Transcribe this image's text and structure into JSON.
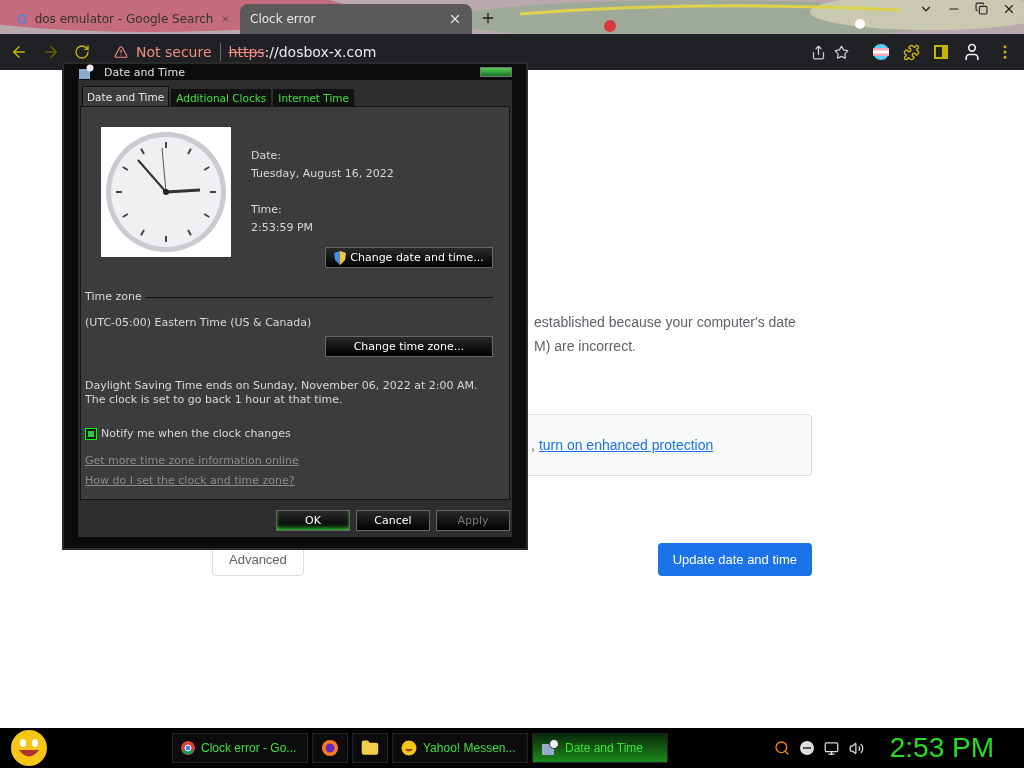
{
  "browser": {
    "tabs": [
      {
        "title": "dos emulator - Google Search",
        "selected": false
      },
      {
        "title": "Clock error",
        "selected": true
      }
    ],
    "security": "Not secure",
    "url_scheme": "https",
    "url_rest": "://dosbox-x.com"
  },
  "page": {
    "lines": [
      "established because your computer's date",
      "M) are incorrect."
    ],
    "card_prefix": ",",
    "card_link": "turn on enhanced protection",
    "advanced_button": "Advanced",
    "update_button": "Update date and time"
  },
  "dialog": {
    "title": "Date and Time",
    "tabs": [
      {
        "label": "Date and Time",
        "selected": true
      },
      {
        "label": "Additional Clocks",
        "selected": false
      },
      {
        "label": "Internet Time",
        "selected": false
      }
    ],
    "date_label": "Date:",
    "date_value": "Tuesday, August 16, 2022",
    "time_label": "Time:",
    "time_value": "2:53:59 PM",
    "change_datetime_button": "Change date and time...",
    "timezone_heading": "Time zone",
    "timezone_value": "(UTC-05:00) Eastern Time (US & Canada)",
    "change_timezone_button": "Change time zone...",
    "dst_note": "Daylight Saving Time ends on Sunday, November 06, 2022 at 2:00 AM. The clock is set to go back 1 hour at that time.",
    "notify": {
      "label": "Notify me when the clock changes",
      "checked": true
    },
    "links": [
      "Get more time zone information online",
      "How do I set the clock and time zone?"
    ],
    "buttons": [
      {
        "label": "OK",
        "disabled": false,
        "default": true
      },
      {
        "label": "Cancel",
        "disabled": false,
        "default": false
      },
      {
        "label": "Apply",
        "disabled": true,
        "default": false
      }
    ]
  },
  "taskbar": {
    "items": [
      {
        "kind": "chrome",
        "label": "Clock error - Go...",
        "selected": false
      },
      {
        "kind": "firefox",
        "selected": false
      },
      {
        "kind": "folder",
        "selected": false
      },
      {
        "kind": "yahoo",
        "label": "Yahoo! Messen...",
        "selected": false
      },
      {
        "kind": "datetime",
        "label": "Date and Time",
        "selected": true
      }
    ],
    "clock": "2:53 PM"
  }
}
